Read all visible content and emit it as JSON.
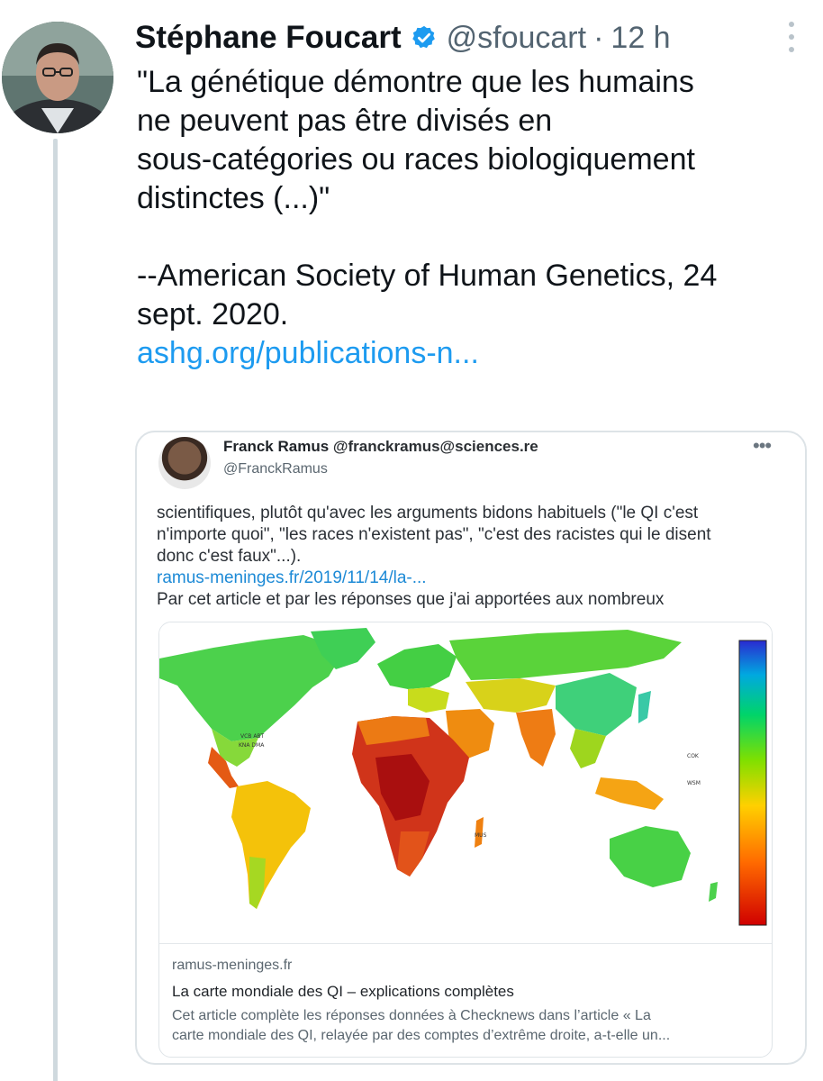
{
  "tweet": {
    "author_name": "Stéphane Foucart",
    "handle": "@sfoucart",
    "separator": "·",
    "time": "12 h",
    "text_lines": [
      "\"La génétique démontre que les humains",
      "ne peuvent pas être divisés en",
      "sous-catégories ou races biologiquement",
      "distinctes (...)\""
    ],
    "attribution_lines": [
      "--American Society of Human Genetics, 24",
      "sept. 2020."
    ],
    "link": "ashg.org/publications-n..."
  },
  "quoted": {
    "author_name": "Franck Ramus",
    "author_alt_handle": "@franckramus@sciences.re",
    "handle": "@FranckRamus",
    "text_lines": [
      "scientifiques, plutôt qu'avec les arguments bidons habituels (\"le QI c'est",
      "n'importe quoi\", \"les races n'existent pas\", \"c'est des racistes qui le disent",
      "donc c'est faux\"...)."
    ],
    "link": "ramus-meninges.fr/2019/11/14/la-...",
    "text_after": "Par cet article et par les réponses que j'ai apportées aux nombreux",
    "link_card": {
      "domain": "ramus-meninges.fr",
      "title": "La carte mondiale des QI – explications complètes",
      "description_lines": [
        "Cet article complète les réponses données à Checknews dans l’article « La",
        "carte mondiale des QI, relayée par des comptes d’extrême droite, a-t-elle un..."
      ]
    }
  },
  "icons": {
    "verified": "verified-badge-icon",
    "more": "more-options-icon"
  },
  "colors": {
    "link": "#1d9bf0",
    "verified": "#1d9bf0",
    "secondary_text": "#536471",
    "thread_line": "#cfd9de"
  }
}
